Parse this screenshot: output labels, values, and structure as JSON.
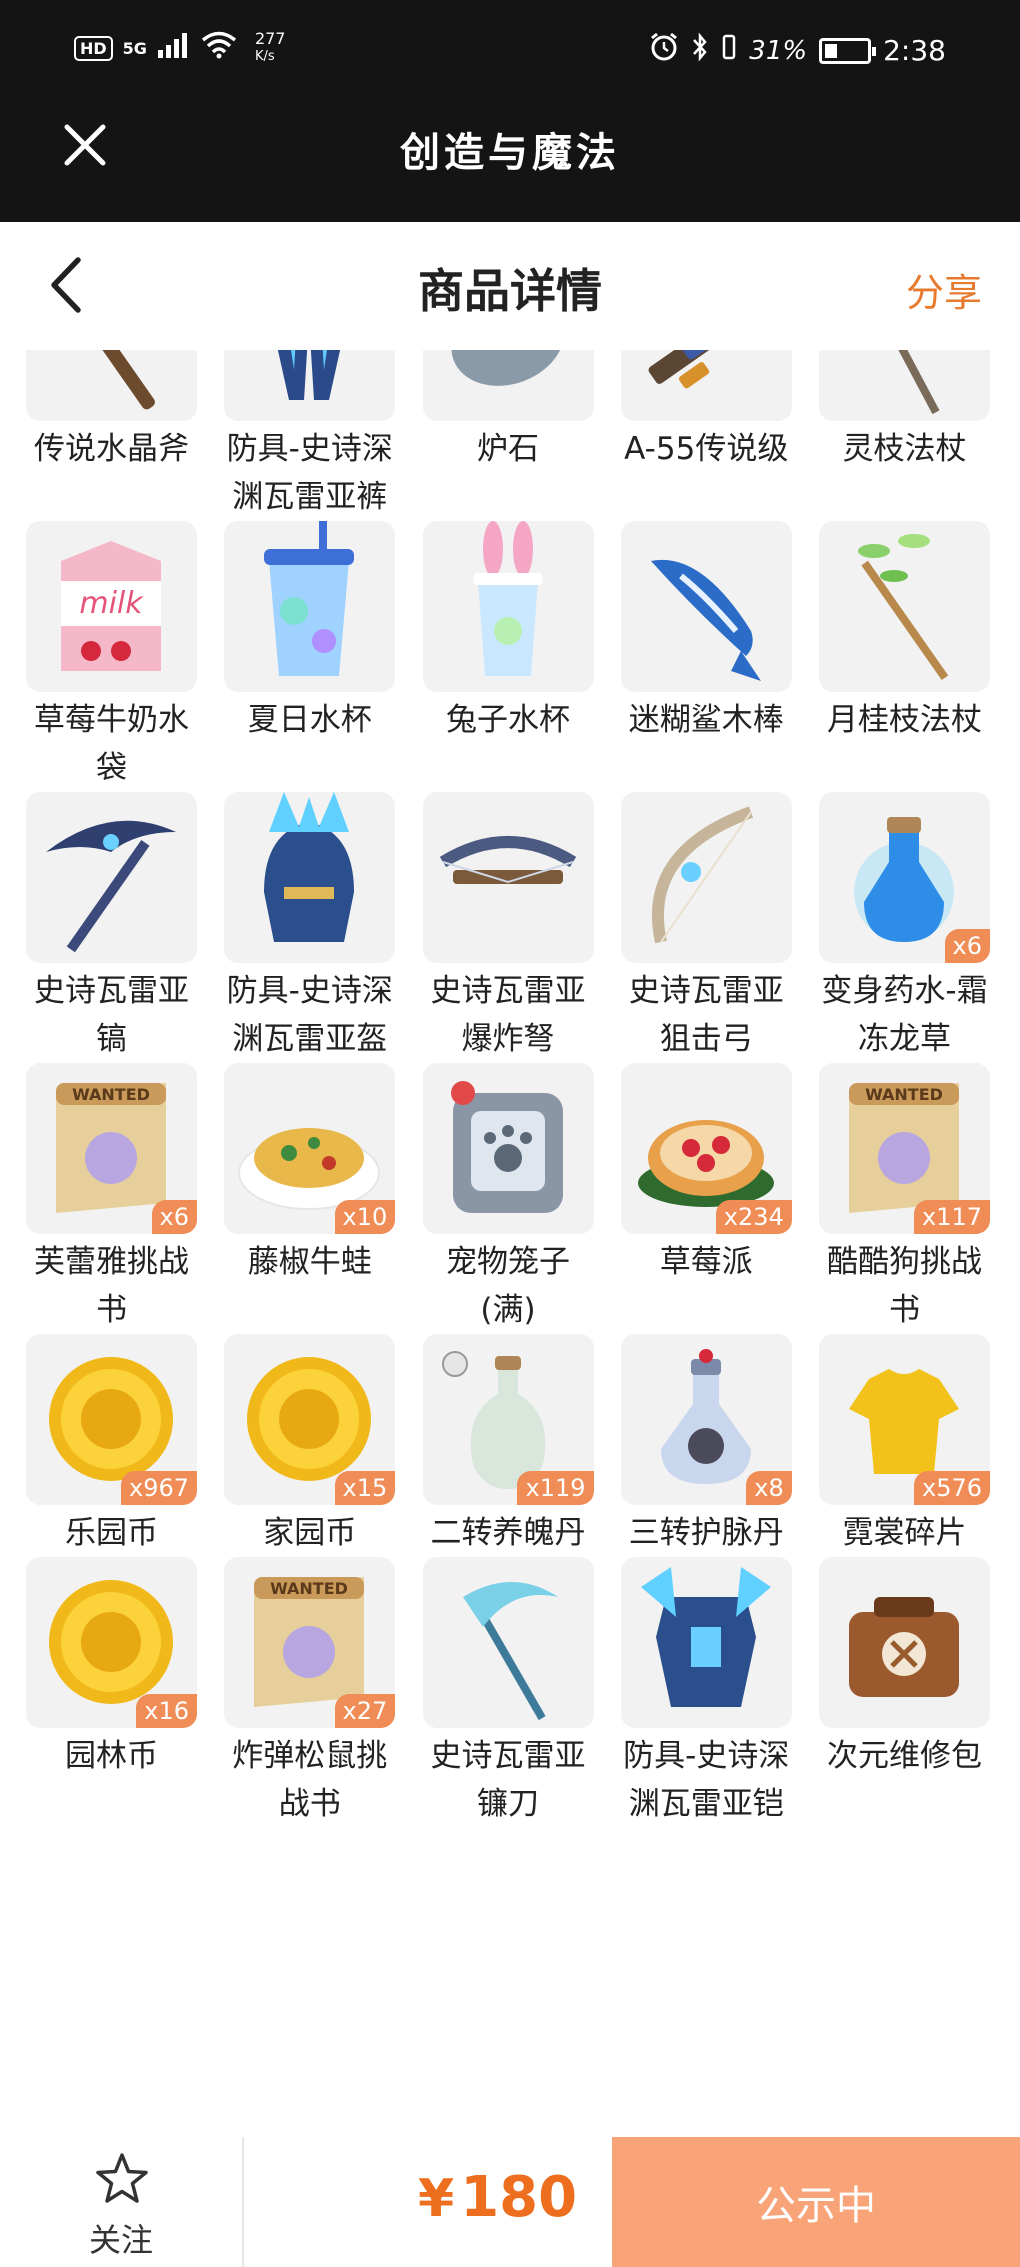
{
  "status_bar": {
    "hd": "HD",
    "network": "5G",
    "speed_value": "277",
    "speed_unit": "K/s",
    "battery_percent": "31",
    "battery_suffix": "%",
    "battery_level": 0.31,
    "time": "2:38"
  },
  "app": {
    "title": "创造与魔法"
  },
  "nav": {
    "title": "商品详情",
    "share": "分享"
  },
  "items": [
    {
      "name": "传说水晶斧",
      "badge": "",
      "icon": "crystal-axe-icon"
    },
    {
      "name": "防具-史诗深渊瓦雷亚裤",
      "badge": "",
      "icon": "armor-pants-icon"
    },
    {
      "name": "炉石",
      "badge": "",
      "icon": "hearthstone-icon"
    },
    {
      "name": "A-55传说级",
      "badge": "",
      "icon": "rifle-icon"
    },
    {
      "name": "灵枝法杖",
      "badge": "",
      "icon": "blossom-staff-icon"
    },
    {
      "name": "草莓牛奶水袋",
      "badge": "",
      "icon": "milk-carton-icon"
    },
    {
      "name": "夏日水杯",
      "badge": "",
      "icon": "summer-cup-icon"
    },
    {
      "name": "兔子水杯",
      "badge": "",
      "icon": "bunny-cup-icon"
    },
    {
      "name": "迷糊鲨木棒",
      "badge": "",
      "icon": "shark-club-icon"
    },
    {
      "name": "月桂枝法杖",
      "badge": "",
      "icon": "laurel-staff-icon"
    },
    {
      "name": "史诗瓦雷亚镐",
      "badge": "",
      "icon": "pickaxe-icon"
    },
    {
      "name": "防具-史诗深渊瓦雷亚盔",
      "badge": "",
      "icon": "helmet-icon"
    },
    {
      "name": "史诗瓦雷亚爆炸弩",
      "badge": "",
      "icon": "crossbow-icon"
    },
    {
      "name": "史诗瓦雷亚狙击弓",
      "badge": "",
      "icon": "bow-icon"
    },
    {
      "name": "变身药水-霜冻龙草",
      "badge": "x6",
      "icon": "potion-icon"
    },
    {
      "name": "芙蕾雅挑战书",
      "badge": "x6",
      "icon": "wanted-scroll-icon"
    },
    {
      "name": "藤椒牛蛙",
      "badge": "x10",
      "icon": "food-plate-icon"
    },
    {
      "name": "宠物笼子(满)",
      "badge": "",
      "icon": "pet-cage-icon"
    },
    {
      "name": "草莓派",
      "badge": "x234",
      "icon": "strawberry-pie-icon"
    },
    {
      "name": "酷酷狗挑战书",
      "badge": "x117",
      "icon": "wanted-scroll-icon"
    },
    {
      "name": "乐园币",
      "badge": "x967",
      "icon": "gold-coin-icon"
    },
    {
      "name": "家园币",
      "badge": "x15",
      "icon": "gold-coin-icon"
    },
    {
      "name": "二转养魄丹",
      "badge": "x119",
      "icon": "vase-icon"
    },
    {
      "name": "三转护脉丹",
      "badge": "x8",
      "icon": "flask-icon"
    },
    {
      "name": "霓裳碎片",
      "badge": "x576",
      "icon": "tshirt-icon"
    },
    {
      "name": "园林币",
      "badge": "x16",
      "icon": "gold-coin-icon"
    },
    {
      "name": "炸弹松鼠挑战书",
      "badge": "x27",
      "icon": "wanted-scroll-icon"
    },
    {
      "name": "史诗瓦雷亚镰刀",
      "badge": "",
      "icon": "scythe-icon"
    },
    {
      "name": "防具-史诗深渊瓦雷亚铠",
      "badge": "",
      "icon": "chest-armor-icon"
    },
    {
      "name": "次元维修包",
      "badge": "",
      "icon": "repair-kit-icon"
    }
  ],
  "bottom": {
    "follow": "关注",
    "currency": "¥",
    "price": "180",
    "status": "公示中"
  },
  "colors": {
    "accent": "#e67a2e",
    "price": "#ec6e1e",
    "status_button": "#f9a478",
    "badge": "#f08c56"
  }
}
